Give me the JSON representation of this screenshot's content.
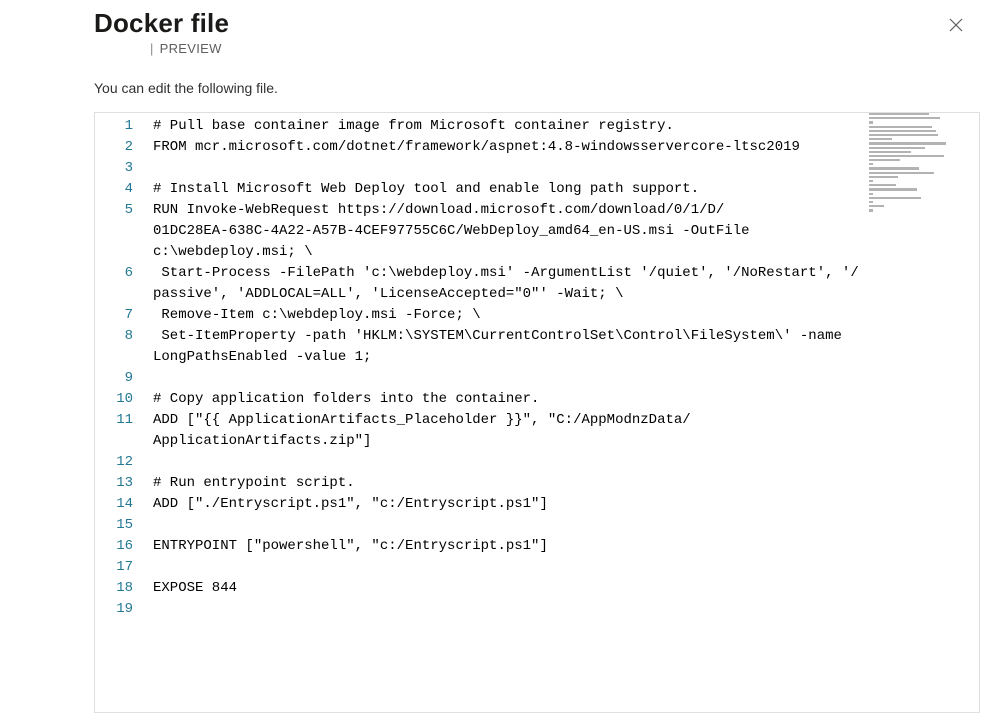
{
  "header": {
    "title": "Docker file",
    "badge_prefix": "|",
    "badge": "PREVIEW",
    "close_tooltip": "Close"
  },
  "hint": "You can edit the following file.",
  "editor": {
    "display_lines": [
      {
        "n": "1",
        "t": "# Pull base container image from Microsoft container registry."
      },
      {
        "n": "2",
        "t": "FROM mcr.microsoft.com/dotnet/framework/aspnet:4.8-windowsservercore-ltsc2019"
      },
      {
        "n": "3",
        "t": ""
      },
      {
        "n": "4",
        "t": "# Install Microsoft Web Deploy tool and enable long path support."
      },
      {
        "n": "5",
        "t": "RUN Invoke-WebRequest https://download.microsoft.com/download/0/1/D/"
      },
      {
        "n": "",
        "t": "01DC28EA-638C-4A22-A57B-4CEF97755C6C/WebDeploy_amd64_en-US.msi -OutFile "
      },
      {
        "n": "",
        "t": "c:\\webdeploy.msi; \\"
      },
      {
        "n": "6",
        "t": " Start-Process -FilePath 'c:\\webdeploy.msi' -ArgumentList '/quiet', '/NoRestart', '/"
      },
      {
        "n": "",
        "t": "passive', 'ADDLOCAL=ALL', 'LicenseAccepted=\"0\"' -Wait; \\"
      },
      {
        "n": "7",
        "t": " Remove-Item c:\\webdeploy.msi -Force; \\"
      },
      {
        "n": "8",
        "t": " Set-ItemProperty -path 'HKLM:\\SYSTEM\\CurrentControlSet\\Control\\FileSystem\\' -name "
      },
      {
        "n": "",
        "t": "LongPathsEnabled -value 1;"
      },
      {
        "n": "9",
        "t": ""
      },
      {
        "n": "10",
        "t": "# Copy application folders into the container."
      },
      {
        "n": "11",
        "t": "ADD [\"{{ ApplicationArtifacts_Placeholder }}\", \"C:/AppModnzData/"
      },
      {
        "n": "",
        "t": "ApplicationArtifacts.zip\"]"
      },
      {
        "n": "12",
        "t": ""
      },
      {
        "n": "13",
        "t": "# Run entrypoint script."
      },
      {
        "n": "14",
        "t": "ADD [\"./Entryscript.ps1\", \"c:/Entryscript.ps1\"]"
      },
      {
        "n": "15",
        "t": ""
      },
      {
        "n": "16",
        "t": "ENTRYPOINT [\"powershell\", \"c:/Entryscript.ps1\"]"
      },
      {
        "n": "17",
        "t": ""
      },
      {
        "n": "18",
        "t": "EXPOSE 844"
      },
      {
        "n": "19",
        "t": ""
      }
    ],
    "minimap_widths_pct": [
      62,
      74,
      4,
      66,
      70,
      72,
      24,
      80,
      58,
      44,
      78,
      32,
      4,
      52,
      68,
      30,
      4,
      28,
      50,
      4,
      54,
      4,
      16,
      4
    ]
  }
}
